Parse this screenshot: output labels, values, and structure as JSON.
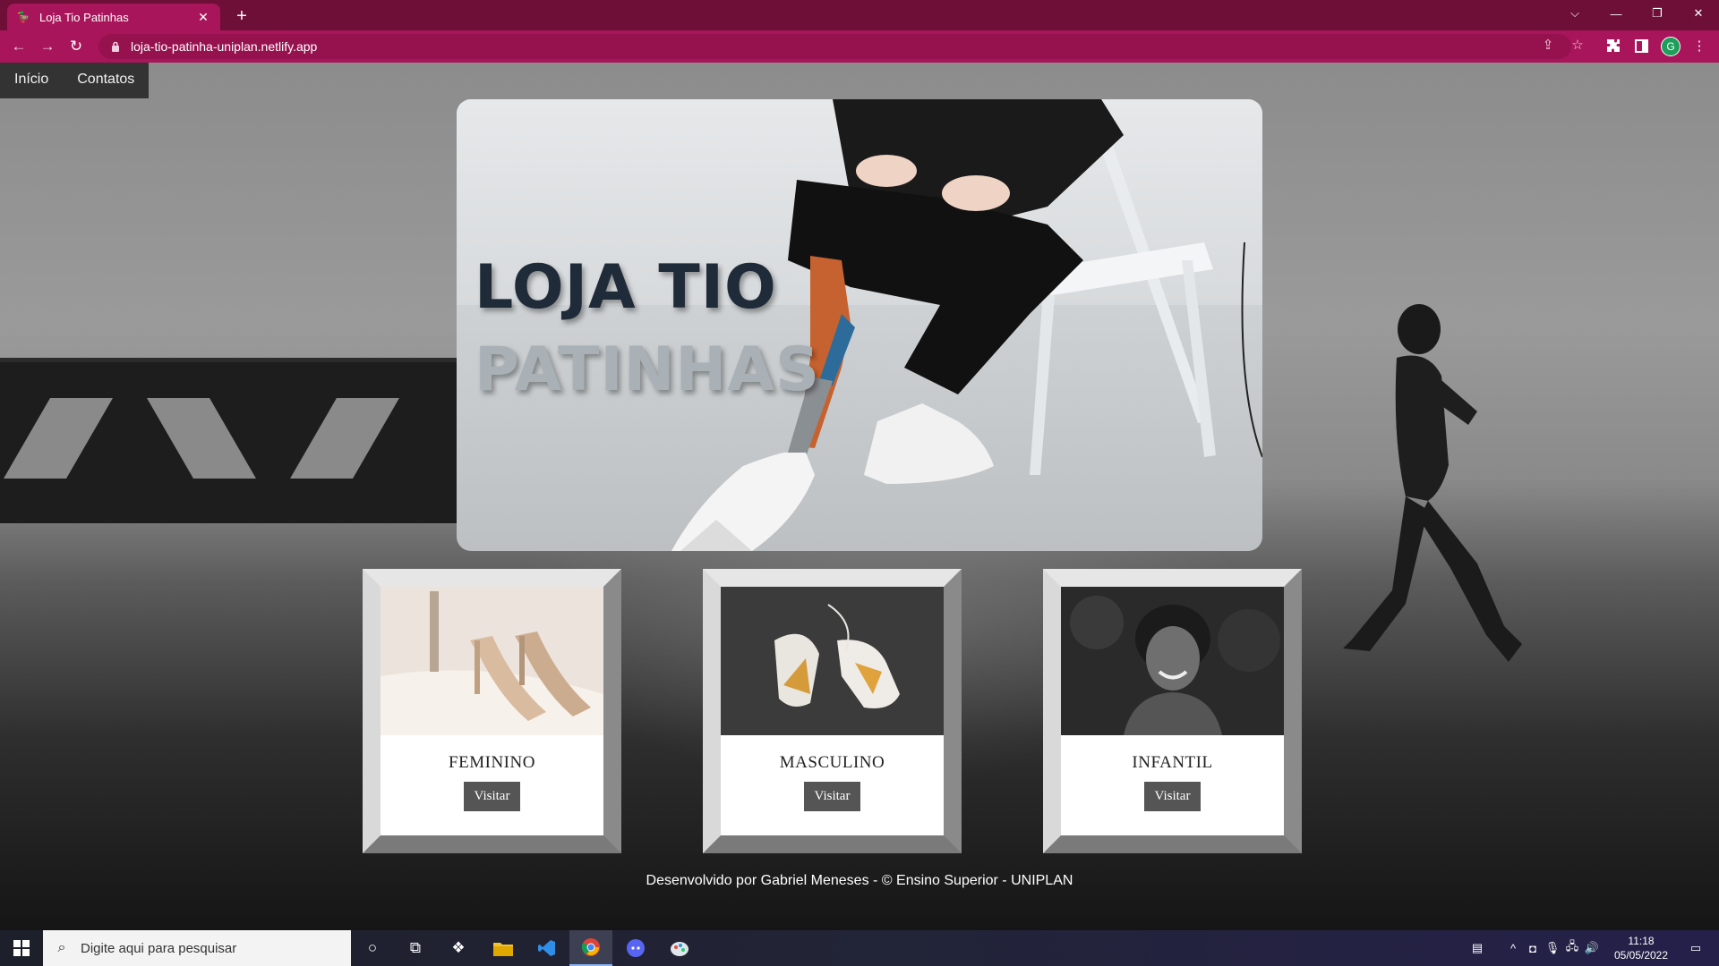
{
  "browser": {
    "tab_title": "Loja Tio Patinhas",
    "url": "loja-tio-patinha-uniplan.netlify.app",
    "profile_initial": "G"
  },
  "nav": {
    "items": [
      "Início",
      "Contatos"
    ]
  },
  "hero": {
    "line1": "LOJA TIO",
    "line2": "PATINHAS"
  },
  "cards": [
    {
      "title": "FEMININO",
      "button": "Visitar"
    },
    {
      "title": "MASCULINO",
      "button": "Visitar"
    },
    {
      "title": "INFANTIL",
      "button": "Visitar"
    }
  ],
  "footer": "Desenvolvido por Gabriel Meneses - © Ensino Superior - UNIPLAN",
  "taskbar": {
    "search_placeholder": "Digite aqui para pesquisar",
    "time": "11:18",
    "date": "05/05/2022"
  },
  "colors": {
    "browser_frame": "#6e0f38",
    "browser_tab_active": "#a8155a",
    "nav_bg": "#333333",
    "button_bg": "#555555"
  }
}
